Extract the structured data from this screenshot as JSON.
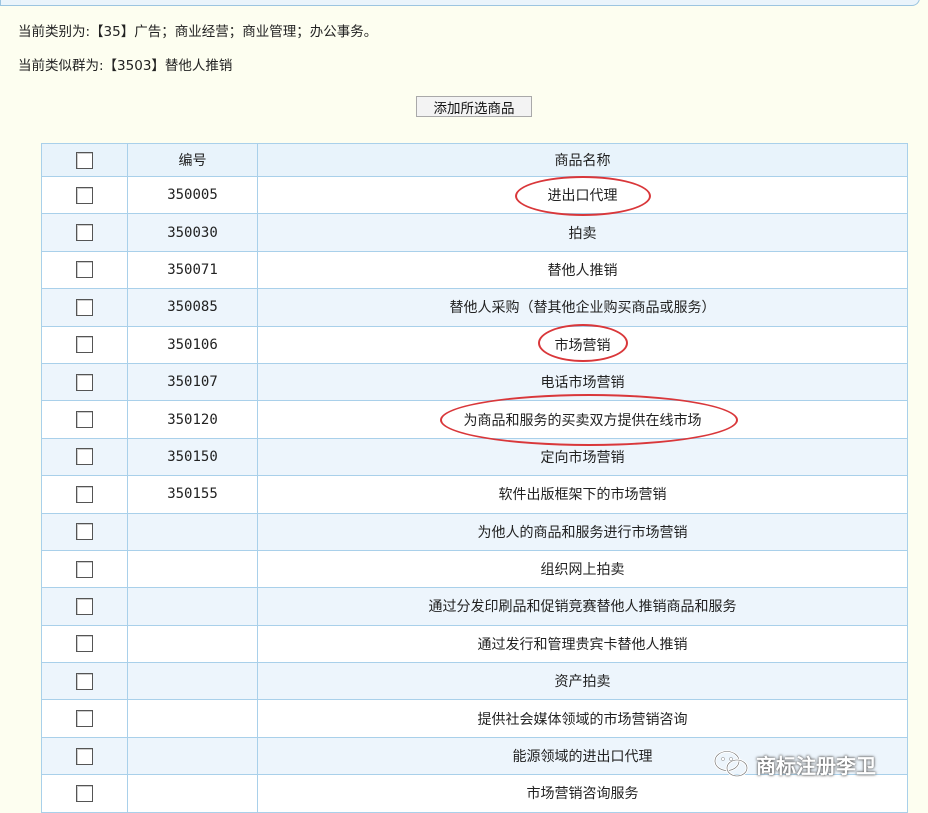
{
  "header": {
    "category_line": "当前类别为:【35】广告；商业经营；商业管理；办公事务。",
    "group_line": "当前类似群为:【3503】替他人推销"
  },
  "toolbar": {
    "add_selected_label": "添加所选商品"
  },
  "table": {
    "columns": [
      "编号",
      "商品名称"
    ],
    "rows": [
      {
        "code": "350005",
        "name": "进出口代理"
      },
      {
        "code": "350030",
        "name": "拍卖"
      },
      {
        "code": "350071",
        "name": "替他人推销"
      },
      {
        "code": "350085",
        "name": "替他人采购（替其他企业购买商品或服务）"
      },
      {
        "code": "350106",
        "name": "市场营销"
      },
      {
        "code": "350107",
        "name": "电话市场营销"
      },
      {
        "code": "350120",
        "name": "为商品和服务的买卖双方提供在线市场"
      },
      {
        "code": "350150",
        "name": "定向市场营销"
      },
      {
        "code": "350155",
        "name": "软件出版框架下的市场营销"
      },
      {
        "code": "",
        "name": "为他人的商品和服务进行市场营销"
      },
      {
        "code": "",
        "name": "组织网上拍卖"
      },
      {
        "code": "",
        "name": "通过分发印刷品和促销竞赛替他人推销商品和服务"
      },
      {
        "code": "",
        "name": "通过发行和管理贵宾卡替他人推销"
      },
      {
        "code": "",
        "name": "资产拍卖"
      },
      {
        "code": "",
        "name": "提供社会媒体领域的市场营销咨询"
      },
      {
        "code": "",
        "name": "能源领域的进出口代理"
      },
      {
        "code": "",
        "name": "市场营销咨询服务"
      }
    ]
  },
  "watermark": {
    "text": "商标注册李卫",
    "icon": "wechat-icon"
  }
}
